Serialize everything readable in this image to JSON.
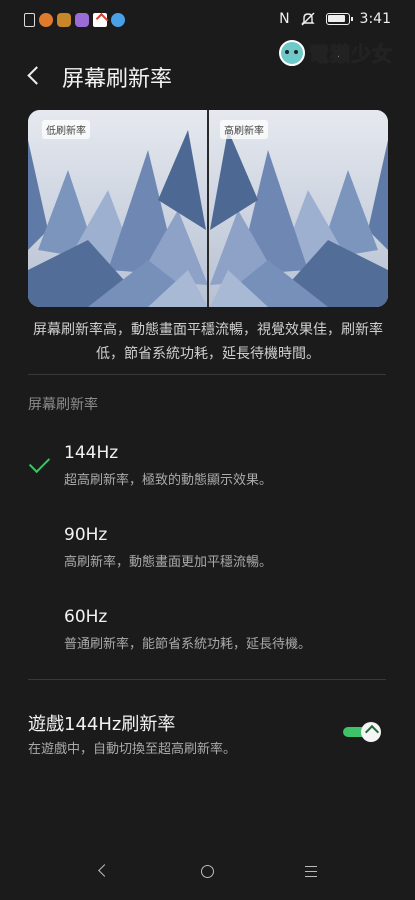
{
  "status_bar": {
    "time": "3:41",
    "nfc_label": "N",
    "left_icons": [
      "document-icon",
      "app-orange-icon",
      "app-amber-icon",
      "app-purple-icon",
      "gmail-icon",
      "wifi-app-icon"
    ],
    "right_icons": [
      "nfc-icon",
      "mute-icon",
      "battery-icon"
    ]
  },
  "watermark": {
    "text": "電獺少女"
  },
  "header": {
    "title": "屏幕刷新率"
  },
  "preview": {
    "left_tag": "低刷新率",
    "right_tag": "高刷新率"
  },
  "description": "屏幕刷新率高，動態畫面平穩流暢，視覺效果佳，刷新率低，節省系統功耗，延長待機時間。",
  "section_label": "屏幕刷新率",
  "options": [
    {
      "title": "144Hz",
      "subtitle": "超高刷新率，極致的動態顯示效果。",
      "selected": true
    },
    {
      "title": "90Hz",
      "subtitle": "高刷新率，動態畫面更加平穩流暢。",
      "selected": false
    },
    {
      "title": "60Hz",
      "subtitle": "普通刷新率，能節省系統功耗，延長待機。",
      "selected": false
    }
  ],
  "game_mode": {
    "title": "遊戲144Hz刷新率",
    "subtitle": "在遊戲中，自動切換至超高刷新率。",
    "enabled": true
  },
  "colors": {
    "accent": "#3ec26a",
    "background": "#1b1b1b"
  }
}
